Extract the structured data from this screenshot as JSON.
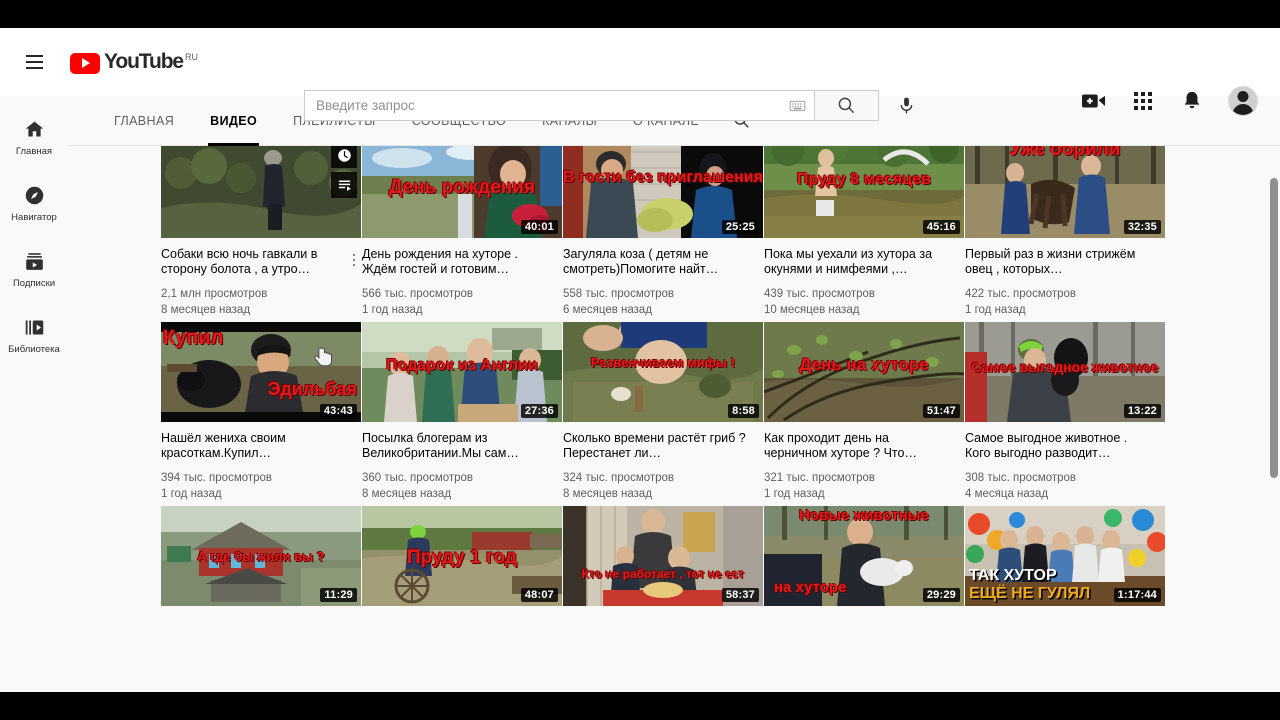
{
  "header": {
    "menu_icon": "hamburger-menu-icon",
    "logo_text": "YouTube",
    "logo_country": "RU",
    "search_placeholder": "Введите запрос",
    "search_value": "",
    "keyboard_icon": "keyboard-icon",
    "search_icon": "search-icon",
    "mic_icon": "microphone-icon",
    "create_icon": "video-camera-plus-icon",
    "apps_icon": "apps-grid-icon",
    "notifications_icon": "bell-icon",
    "avatar_icon": "user-avatar"
  },
  "sidebar": {
    "items": [
      {
        "label": "Главная",
        "icon": "home-icon"
      },
      {
        "label": "Навигатор",
        "icon": "compass-icon"
      },
      {
        "label": "Подписки",
        "icon": "subscriptions-icon"
      },
      {
        "label": "Библиотека",
        "icon": "library-icon"
      }
    ]
  },
  "channel_tabs": {
    "items": [
      {
        "label": "ГЛАВНАЯ",
        "active": false
      },
      {
        "label": "ВИДЕО",
        "active": true
      },
      {
        "label": "ПЛЕЙЛИСТЫ",
        "active": false
      },
      {
        "label": "СООБЩЕСТВО",
        "active": false
      },
      {
        "label": "КАНАЛЫ",
        "active": false
      },
      {
        "label": "О КАНАЛЕ",
        "active": false
      }
    ],
    "search_icon": "search-icon"
  },
  "hover_actions": {
    "watch_later": "clock-icon",
    "add_to_queue": "add-to-queue-icon"
  },
  "videos": [
    {
      "title": "Собаки всю ночь гавкали в стороны болота , а утро...",
      "title_display": "Собаки всю ночь гавкали в сторону болота , а утро…",
      "views": "2,1 млн просмотров",
      "age": "8 месяцев назад",
      "duration": "",
      "overlay_text": "",
      "hovered": true
    },
    {
      "title_display": "День рождения на хуторе . Ждём гостей и готовим…",
      "views": "566 тыс. просмотров",
      "age": "1 год назад",
      "duration": "40:01",
      "overlay_text": "День рождения",
      "hovered": false
    },
    {
      "title_display": "Загуляла коза ( детям не смотреть)Помогите найт…",
      "views": "558 тыс. просмотров",
      "age": "6 месяцев назад",
      "duration": "25:25",
      "overlay_text": "В гости без приглашения",
      "hovered": false
    },
    {
      "title_display": "Пока мы уехали из хутора за окунями и нимфеями ,…",
      "views": "439 тыс. просмотров",
      "age": "10 месяцев назад",
      "duration": "45:16",
      "overlay_text": "Пруду 8 месяцев",
      "hovered": false
    },
    {
      "title_display": "Первый раз в жизни стрижём овец , которых…",
      "views": "422 тыс. просмотров",
      "age": "1 год назад",
      "duration": "32:35",
      "overlay_text": "Уже обрили",
      "hovered": false
    },
    {
      "title_display": "Нашёл жениха своим красоткам.Купил…",
      "views": "394 тыс. просмотров",
      "age": "1 год назад",
      "duration": "43:43",
      "overlay_text": "Купил Эдильбая",
      "hovered": false
    },
    {
      "title_display": "Посылка блогерам из Великобритании.Мы сам…",
      "views": "360 тыс. просмотров",
      "age": "8 месяцев назад",
      "duration": "27:36",
      "overlay_text": "Подарок из Англии",
      "hovered": false
    },
    {
      "title_display": "Сколько времени растёт гриб ? Перестанет ли…",
      "views": "324 тыс. просмотров",
      "age": "8 месяцев назад",
      "duration": "8:58",
      "overlay_text": "Развенчиваем мифы !",
      "hovered": false
    },
    {
      "title_display": "Как проходит день на черничном хуторе ? Что…",
      "views": "321 тыс. просмотров",
      "age": "1 год назад",
      "duration": "51:47",
      "overlay_text": "День на хуторе",
      "hovered": false
    },
    {
      "title_display": "Самое выгодное животное . Кого выгодно разводит…",
      "views": "308 тыс. просмотров",
      "age": "4 месяца назад",
      "duration": "13:22",
      "overlay_text": "Самое выгодное животное",
      "hovered": false
    },
    {
      "title_display": "",
      "views": "",
      "age": "",
      "duration": "11:29",
      "overlay_text": "А где бы жили вы ?",
      "hovered": false
    },
    {
      "title_display": "",
      "views": "",
      "age": "",
      "duration": "48:07",
      "overlay_text": "Пруду 1 год",
      "hovered": false
    },
    {
      "title_display": "",
      "views": "",
      "age": "",
      "duration": "58:37",
      "overlay_text": "Кто не работает , тот не ест",
      "hovered": false
    },
    {
      "title_display": "",
      "views": "",
      "age": "",
      "duration": "29:29",
      "overlay_text": "Новые животные на хуторе",
      "hovered": false
    },
    {
      "title_display": "",
      "views": "",
      "age": "",
      "duration": "1:17:44",
      "overlay_text": "ТАК ХУТОР ЕЩЁ НЕ ГУЛЯЛ",
      "hovered": false
    }
  ],
  "colors": {
    "brand_red": "#ff0000",
    "overlay_red": "#e01b1b",
    "page_bg": "#f9f9f9",
    "text_primary": "#030303",
    "text_secondary": "#606060"
  }
}
